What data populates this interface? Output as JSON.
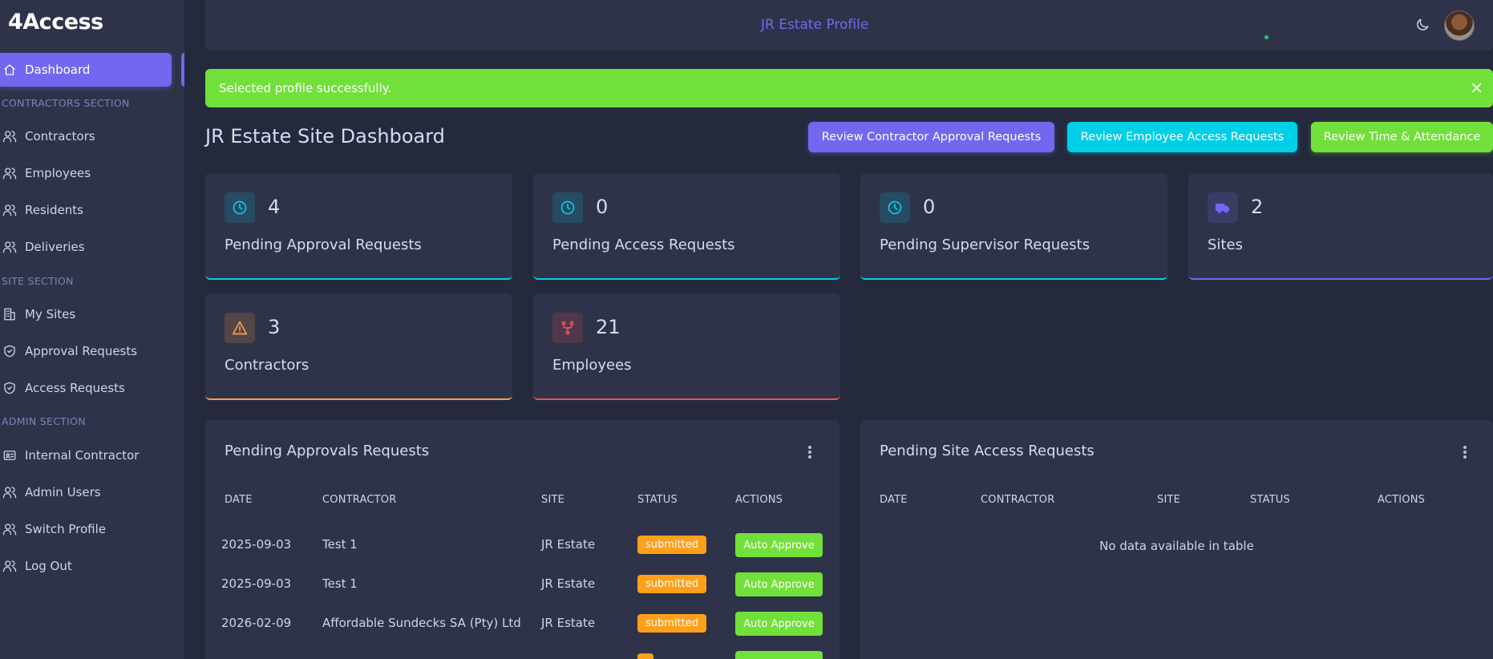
{
  "app": {
    "brand": "4Access"
  },
  "sidebar": {
    "active": {
      "label": "Dashboard",
      "icon": "home-icon"
    },
    "sections": [
      {
        "header": "CONTRACTORS SECTION",
        "items": [
          {
            "label": "Contractors",
            "icon": "users-icon"
          },
          {
            "label": "Employees",
            "icon": "users-icon"
          },
          {
            "label": "Residents",
            "icon": "users-icon"
          },
          {
            "label": "Deliveries",
            "icon": "users-icon"
          }
        ]
      },
      {
        "header": "SITE SECTION",
        "items": [
          {
            "label": "My Sites",
            "icon": "building-icon"
          },
          {
            "label": "Approval Requests",
            "icon": "shield-check-icon"
          },
          {
            "label": "Access Requests",
            "icon": "shield-check-icon"
          }
        ]
      },
      {
        "header": "ADMIN SECTION",
        "items": [
          {
            "label": "Internal Contractor",
            "icon": "id-card-icon"
          },
          {
            "label": "Admin Users",
            "icon": "users-icon"
          },
          {
            "label": "Switch Profile",
            "icon": "users-icon"
          },
          {
            "label": "Log Out",
            "icon": "users-icon"
          }
        ]
      }
    ]
  },
  "topbar": {
    "title": "JR Estate Profile",
    "theme_icon": "moon-icon",
    "avatar": "user-avatar"
  },
  "alert": {
    "message": "Selected profile successfully.",
    "close": "×",
    "color": "#72e03a"
  },
  "header": {
    "title": "JR Estate Site Dashboard",
    "actions": [
      {
        "label": "Review Contractor Approval Requests",
        "color": "#7367f0"
      },
      {
        "label": "Review Employee Access Requests",
        "color": "#00cfe8"
      },
      {
        "label": "Review Time & Attendance",
        "color": "#72e03a"
      }
    ]
  },
  "stats": [
    {
      "value": "4",
      "label": "Pending Approval Requests",
      "icon": "clock-icon",
      "accent": "#00cfe8"
    },
    {
      "value": "0",
      "label": "Pending Access Requests",
      "icon": "clock-icon",
      "accent": "#00cfe8"
    },
    {
      "value": "0",
      "label": "Pending Supervisor Requests",
      "icon": "clock-icon",
      "accent": "#00cfe8"
    },
    {
      "value": "2",
      "label": "Sites",
      "icon": "truck-icon",
      "accent": "#7367f0"
    },
    {
      "value": "3",
      "label": "Contractors",
      "icon": "alert-triangle-icon",
      "accent": "#ff9f43"
    },
    {
      "value": "21",
      "label": "Employees",
      "icon": "git-fork-icon",
      "accent": "#ea5455"
    }
  ],
  "pending_approvals": {
    "title": "Pending Approvals Requests",
    "columns": [
      "DATE",
      "CONTRACTOR",
      "SITE",
      "STATUS",
      "ACTIONS"
    ],
    "rows": [
      {
        "date": "2025-09-03",
        "contractor": "Test 1",
        "site": "JR Estate",
        "status": "submitted",
        "action": "Auto Approve"
      },
      {
        "date": "2025-09-03",
        "contractor": "Test 1",
        "site": "JR Estate",
        "status": "submitted",
        "action": "Auto Approve"
      },
      {
        "date": "2026-02-09",
        "contractor": "Affordable Sundecks SA (Pty) Ltd",
        "site": "JR Estate",
        "status": "submitted",
        "action": "Auto Approve"
      }
    ]
  },
  "pending_site_access": {
    "title": "Pending Site Access Requests",
    "columns": [
      "DATE",
      "CONTRACTOR",
      "SITE",
      "STATUS",
      "ACTIONS"
    ],
    "empty_message": "No data available in table"
  }
}
